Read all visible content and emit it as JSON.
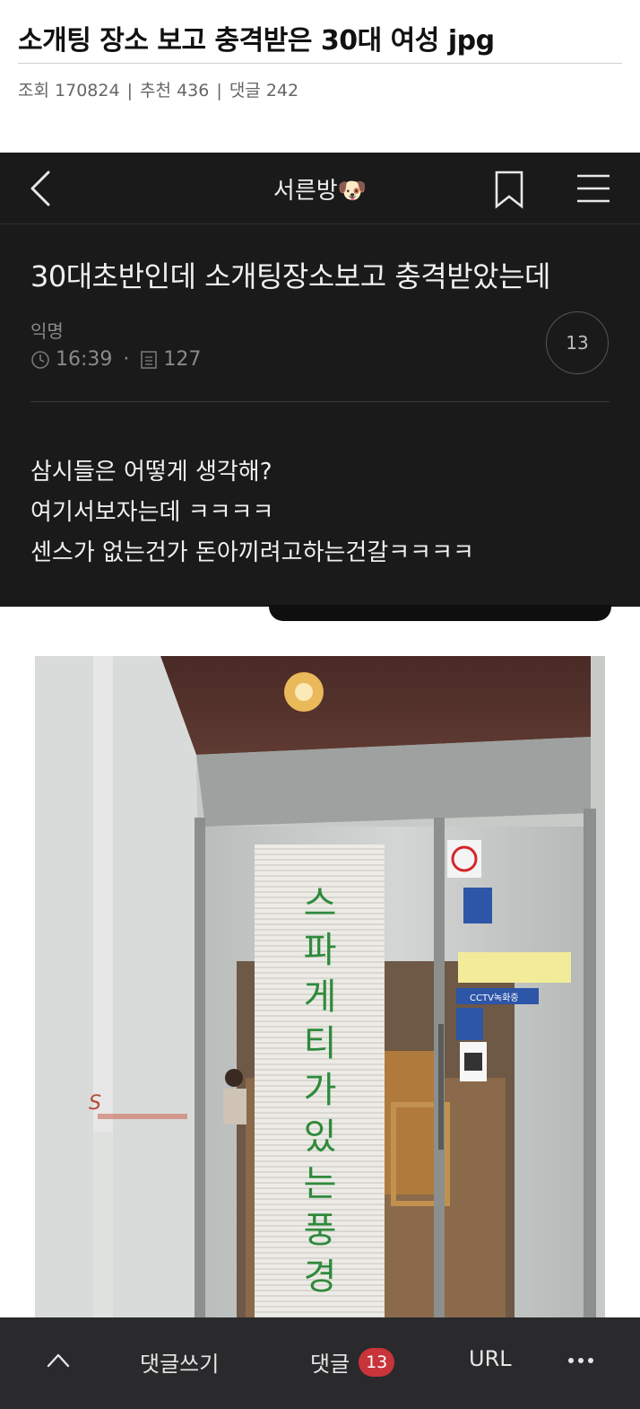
{
  "post": {
    "title": "소개팅 장소 보고 충격받은 30대 여성 jpg",
    "views_label": "조회",
    "views": "170824",
    "recommend_label": "추천",
    "recommend": "436",
    "comments_label": "댓글",
    "comments": "242"
  },
  "app": {
    "header_title": "서른방🐶",
    "post_title": "30대초반인데 소개팅장소보고 충격받았는데",
    "author": "익명",
    "time": "16:39",
    "read_count": "127",
    "comment_count": "13",
    "body_lines": [
      "삼시들은 어떻게 생각해?",
      "여기서보자는데 ㅋㅋㅋㅋ",
      "센스가 없는건가 돈아끼려고하는건갈ㅋㅋㅋㅋ"
    ],
    "icons": {
      "back": "chevron-left-icon",
      "bookmark": "bookmark-icon",
      "menu": "hamburger-menu-icon",
      "clock": "clock-icon",
      "document": "document-icon"
    }
  },
  "photo": {
    "door_lettering": "스파게티가 있는 풍경",
    "sign_text": "CCTV녹화중"
  },
  "bottom_bar": {
    "write_label": "댓글쓰기",
    "comments_label": "댓글",
    "comments_badge": "13",
    "url_label": "URL",
    "icons": {
      "up": "chevron-up-icon",
      "more": "more-dots-icon"
    }
  },
  "colors": {
    "app_background": "#1a1a1a",
    "bottom_bar_background": "#2a2a2c",
    "badge": "#c8343a"
  }
}
